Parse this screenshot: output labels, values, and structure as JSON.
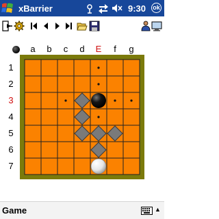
{
  "titlebar": {
    "app_title": "xBarrier",
    "clock": "9:30",
    "close_label": "ok",
    "colors": {
      "bar": "#17479a"
    }
  },
  "toolbar": {
    "icons": [
      "exit-icon",
      "settings-gear-icon",
      "first-move-icon",
      "previous-move-icon",
      "next-move-icon",
      "last-move-icon",
      "open-folder-icon",
      "save-disk-icon",
      "players-icon",
      "screen-icon"
    ]
  },
  "board": {
    "columns": [
      "a",
      "b",
      "c",
      "d",
      "E",
      "f",
      "g"
    ],
    "rows": [
      "1",
      "2",
      "3",
      "4",
      "5",
      "6",
      "7"
    ],
    "highlight_column": "E",
    "highlight_row": "3",
    "colors": {
      "board": "#fb8200",
      "frame": "#7b7a0b",
      "grid": "#222222",
      "barrier": "#7a7a7a",
      "highlight": "#d01010"
    },
    "black_stone": "e3",
    "white_stone": "e7",
    "barriers": [
      "d3",
      "d4",
      "d5",
      "e5",
      "f5",
      "e6"
    ],
    "move_hints": [
      "e1",
      "e2",
      "c3",
      "f3",
      "g3",
      "e4"
    ]
  },
  "menubar": {
    "game_label": "Game",
    "caret": "▲"
  }
}
